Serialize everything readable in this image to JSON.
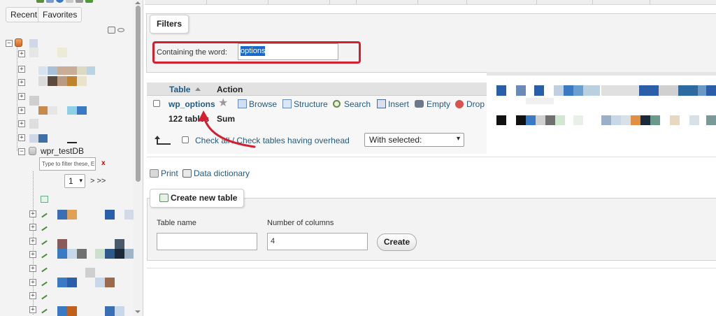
{
  "nav": {
    "tabs": [
      "Recent",
      "Favorites"
    ],
    "database_name": "wpr_testDB",
    "filter_placeholder": "Type to filter these, E",
    "filter_clear": "x",
    "page_select_value": "1",
    "page_next": "> >>"
  },
  "filters": {
    "legend": "Filters",
    "label": "Containing the word:",
    "value": "options"
  },
  "table_list": {
    "header_table": "Table",
    "header_action": "Action",
    "rows": [
      {
        "name": "wp_options",
        "actions": [
          "Browse",
          "Structure",
          "Search",
          "Insert",
          "Empty",
          "Drop"
        ]
      }
    ],
    "summary_count": "122 tables",
    "summary_label": "Sum",
    "check_all": "Check all / Check tables having overhead",
    "with_selected": "With selected:"
  },
  "links": {
    "print": "Print",
    "data_dictionary": "Data dictionary"
  },
  "create_table": {
    "legend": "Create new table",
    "table_name_label": "Table name",
    "table_name_value": "",
    "columns_label": "Number of columns",
    "columns_value": "4",
    "button": "Create"
  },
  "colors": {
    "link": "#235a81",
    "highlight": "#d32031",
    "selection": "#1a68c9"
  }
}
